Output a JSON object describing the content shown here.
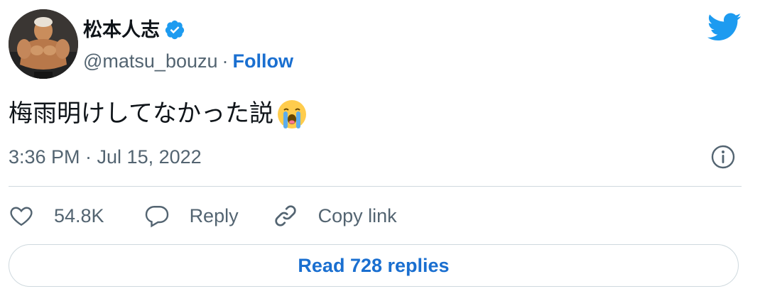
{
  "author": {
    "display_name": "松本人志",
    "handle": "@matsu_bouzu",
    "separator": "·",
    "follow_label": "Follow",
    "verified": true
  },
  "tweet": {
    "text": "梅雨明けしてなかった説",
    "emoji_icon": "loudly-crying-face-icon",
    "timestamp": "3:36 PM · Jul 15, 2022"
  },
  "actions": {
    "like_count": "54.8K",
    "reply_label": "Reply",
    "copy_link_label": "Copy link"
  },
  "read_replies_label": "Read 728 replies",
  "colors": {
    "accent": "#1a6fd0",
    "twitter_blue": "#1d9bf0",
    "muted_text": "#536471",
    "border": "#cfd9de"
  }
}
